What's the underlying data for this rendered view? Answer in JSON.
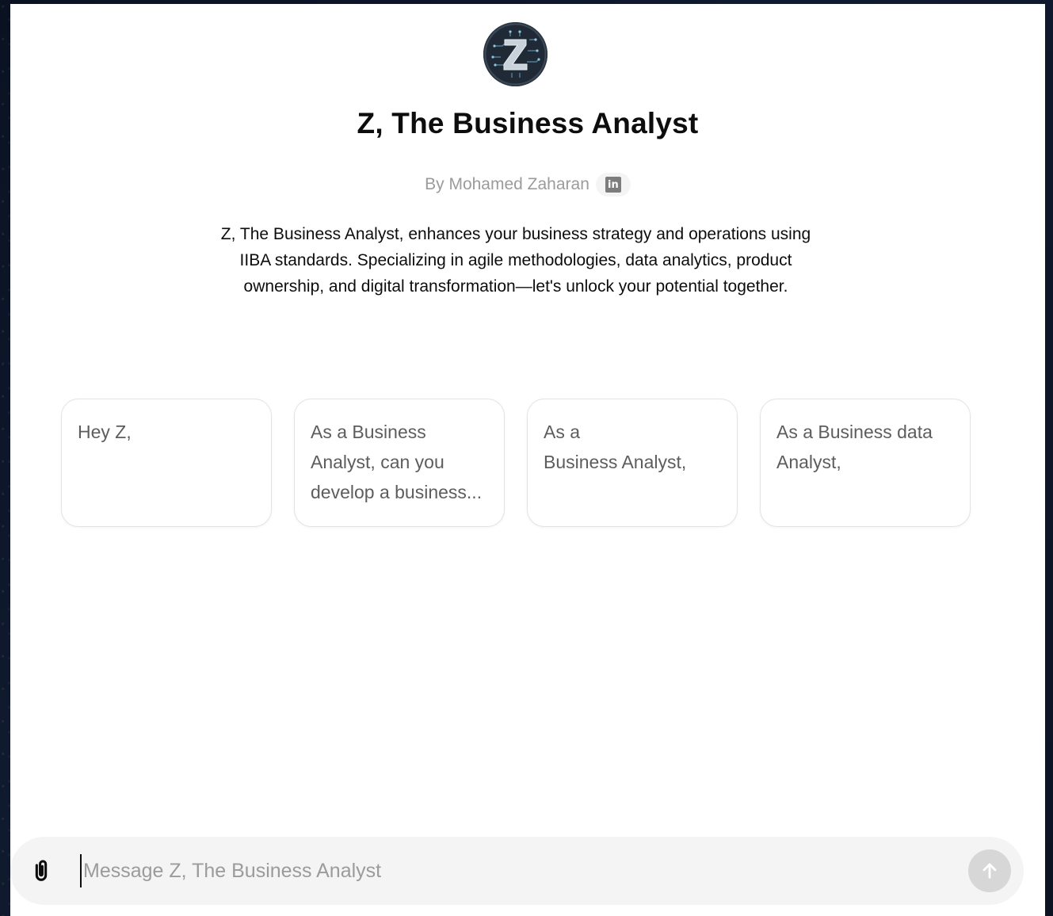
{
  "gpt": {
    "name": "Z, The Business Analyst",
    "byline": "By Mohamed Zaharan",
    "social_badge": "in",
    "description": "Z, The Business Analyst, enhances your business strategy and operations using IIBA standards. Specializing in agile methodologies, data analytics, product ownership, and digital transformation—let's unlock your potential together.",
    "avatar_icon": "z-circuit-logo-icon"
  },
  "starters": [
    {
      "text": "Hey Z,"
    },
    {
      "text": "As a Business Analyst, can you develop a business..."
    },
    {
      "text": "As a\nBusiness Analyst,"
    },
    {
      "text": "As a Business data Analyst,"
    }
  ],
  "composer": {
    "placeholder": "Message Z, The Business Analyst",
    "value": "",
    "attach_icon": "paperclip-icon",
    "send_icon": "arrow-up-icon"
  },
  "colors": {
    "background": "#0b1220",
    "panel": "#ffffff",
    "composer_bg": "#f4f4f4",
    "send_disabled": "#d7d7d7",
    "muted_text": "#9b9b9b"
  }
}
